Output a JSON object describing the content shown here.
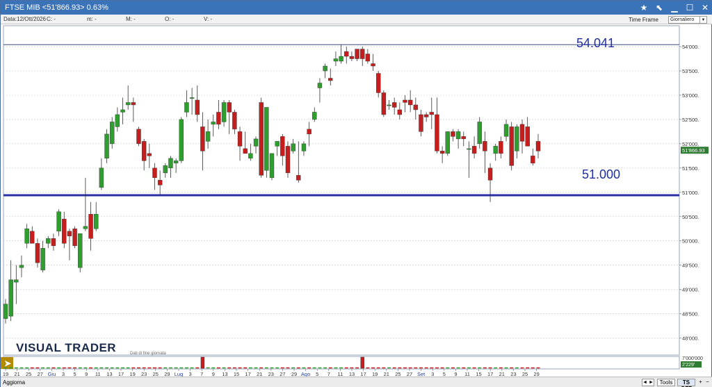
{
  "window": {
    "title": "FTSE MIB <51'866.93> 0.63%"
  },
  "infobar": {
    "date": "Data:12/Ott/2026",
    "c": "C:  -",
    "m": "m:  -",
    "M": "M:  -",
    "O": "O:  -",
    "V": "V:  -"
  },
  "timeframe": {
    "label": "Time Frame",
    "value": "Giornaliero"
  },
  "branding": {
    "logo": "VISUAL TRADER",
    "subtitle": "Dati di fine giornata"
  },
  "annotations": {
    "upper": "54.041",
    "lower": "51.000"
  },
  "price_label": "51'866.93",
  "volume_labels": {
    "top": "7'000'000",
    "current": "2'229'"
  },
  "statusbar": {
    "aggiorna": "Aggiorna",
    "tools": "Tools",
    "tsoff": "TS OFF",
    "plus": "+",
    "minus": "−",
    "scroll": "◄ ►"
  },
  "chart_data": {
    "type": "candlestick",
    "y_ticks": [
      54000,
      53500,
      53000,
      52500,
      52000,
      51500,
      51000,
      50500,
      50000,
      49500,
      49000,
      48500,
      48000
    ],
    "y_tick_labels": [
      "54'000.",
      "53'500.",
      "53'000.",
      "52'500.",
      "52'000.",
      "51'500.",
      "51'000.",
      "50'500.",
      "50'000.",
      "49'500.",
      "49'000.",
      "48'500.",
      "48'000."
    ],
    "ylim": [
      47600,
      54400
    ],
    "horizontal_lines": [
      54041,
      50940
    ],
    "x_tick_labels": [
      "19",
      "21",
      "25",
      "27",
      "Giu",
      "3",
      "5",
      "9",
      "11",
      "13",
      "17",
      "19",
      "23",
      "25",
      "29",
      "Lug",
      "3",
      "7",
      "9",
      "13",
      "15",
      "17",
      "21",
      "23",
      "27",
      "29",
      "Ago",
      "5",
      "7",
      "11",
      "13",
      "17",
      "19",
      "21",
      "25",
      "27",
      "Set",
      "3",
      "5",
      "9",
      "11",
      "15",
      "17",
      "21",
      "23",
      "25",
      "29"
    ],
    "month_labels": [
      "Giu",
      "Lug",
      "Ago",
      "Set"
    ],
    "current_price": 51866.93,
    "candles": [
      {
        "o": 48400,
        "h": 48800,
        "l": 48300,
        "c": 48700
      },
      {
        "o": 48450,
        "h": 49600,
        "l": 48350,
        "c": 49200
      },
      {
        "o": 49150,
        "h": 49500,
        "l": 48700,
        "c": 49200
      },
      {
        "o": 49450,
        "h": 49700,
        "l": 49250,
        "c": 49500
      },
      {
        "o": 49950,
        "h": 50350,
        "l": 49850,
        "c": 50250
      },
      {
        "o": 50200,
        "h": 50300,
        "l": 49950,
        "c": 49950
      },
      {
        "o": 49950,
        "h": 50050,
        "l": 49450,
        "c": 49550
      },
      {
        "o": 49400,
        "h": 50000,
        "l": 49350,
        "c": 49850
      },
      {
        "o": 49950,
        "h": 50100,
        "l": 49850,
        "c": 50050
      },
      {
        "o": 50050,
        "h": 50150,
        "l": 49800,
        "c": 49900
      },
      {
        "o": 50200,
        "h": 50650,
        "l": 50100,
        "c": 50600
      },
      {
        "o": 50450,
        "h": 50600,
        "l": 49850,
        "c": 49950
      },
      {
        "o": 50200,
        "h": 50250,
        "l": 49600,
        "c": 50100
      },
      {
        "o": 50250,
        "h": 50300,
        "l": 49850,
        "c": 49900
      },
      {
        "o": 49450,
        "h": 50150,
        "l": 49350,
        "c": 50150
      },
      {
        "o": 50250,
        "h": 51300,
        "l": 50200,
        "c": 50300
      },
      {
        "o": 50550,
        "h": 50800,
        "l": 49800,
        "c": 50050
      },
      {
        "o": 50250,
        "h": 50800,
        "l": 50200,
        "c": 50550
      },
      {
        "o": 51100,
        "h": 51700,
        "l": 51050,
        "c": 51500
      },
      {
        "o": 51700,
        "h": 52300,
        "l": 51600,
        "c": 52200
      },
      {
        "o": 52000,
        "h": 52550,
        "l": 51900,
        "c": 52450
      },
      {
        "o": 52350,
        "h": 52750,
        "l": 52250,
        "c": 52600
      },
      {
        "o": 52650,
        "h": 52950,
        "l": 52400,
        "c": 52700
      },
      {
        "o": 52800,
        "h": 53200,
        "l": 52700,
        "c": 52850
      },
      {
        "o": 52850,
        "h": 52950,
        "l": 52450,
        "c": 52800
      },
      {
        "o": 52300,
        "h": 52350,
        "l": 51950,
        "c": 52000
      },
      {
        "o": 52050,
        "h": 52100,
        "l": 51450,
        "c": 51650
      },
      {
        "o": 51800,
        "h": 52000,
        "l": 51500,
        "c": 51750
      },
      {
        "o": 51500,
        "h": 51600,
        "l": 51050,
        "c": 51300
      },
      {
        "o": 51250,
        "h": 51450,
        "l": 50950,
        "c": 51150
      },
      {
        "o": 51400,
        "h": 51600,
        "l": 51300,
        "c": 51550
      },
      {
        "o": 51500,
        "h": 51750,
        "l": 51300,
        "c": 51700
      },
      {
        "o": 51600,
        "h": 51700,
        "l": 51400,
        "c": 51650
      },
      {
        "o": 51650,
        "h": 52550,
        "l": 51600,
        "c": 52500
      },
      {
        "o": 52650,
        "h": 53100,
        "l": 52550,
        "c": 52850
      },
      {
        "o": 52950,
        "h": 53150,
        "l": 52600,
        "c": 52950
      },
      {
        "o": 52900,
        "h": 53200,
        "l": 52450,
        "c": 52600
      },
      {
        "o": 52350,
        "h": 52650,
        "l": 51450,
        "c": 51850
      },
      {
        "o": 52050,
        "h": 52500,
        "l": 51900,
        "c": 52250
      },
      {
        "o": 52400,
        "h": 52600,
        "l": 52150,
        "c": 52450
      },
      {
        "o": 52650,
        "h": 52900,
        "l": 52300,
        "c": 52400
      },
      {
        "o": 52450,
        "h": 52900,
        "l": 52350,
        "c": 52850
      },
      {
        "o": 52850,
        "h": 52900,
        "l": 52200,
        "c": 52650
      },
      {
        "o": 52650,
        "h": 52700,
        "l": 52200,
        "c": 52300
      },
      {
        "o": 52250,
        "h": 52350,
        "l": 51650,
        "c": 51950
      },
      {
        "o": 51900,
        "h": 52250,
        "l": 51800,
        "c": 51800
      },
      {
        "o": 51700,
        "h": 52000,
        "l": 51650,
        "c": 51800
      },
      {
        "o": 51950,
        "h": 52150,
        "l": 51800,
        "c": 52100
      },
      {
        "o": 52850,
        "h": 52950,
        "l": 51300,
        "c": 51350
      },
      {
        "o": 51450,
        "h": 52750,
        "l": 51300,
        "c": 52750
      },
      {
        "o": 51300,
        "h": 51800,
        "l": 51250,
        "c": 51800
      },
      {
        "o": 51950,
        "h": 52050,
        "l": 51750,
        "c": 52050
      },
      {
        "o": 52150,
        "h": 52200,
        "l": 51550,
        "c": 51750
      },
      {
        "o": 51950,
        "h": 52050,
        "l": 51300,
        "c": 51400
      },
      {
        "o": 51850,
        "h": 52100,
        "l": 51800,
        "c": 52000
      },
      {
        "o": 51350,
        "h": 52050,
        "l": 51200,
        "c": 51250
      },
      {
        "o": 51850,
        "h": 52050,
        "l": 51750,
        "c": 52000
      },
      {
        "o": 52300,
        "h": 52450,
        "l": 51950,
        "c": 52200
      },
      {
        "o": 52500,
        "h": 52750,
        "l": 52450,
        "c": 52650
      },
      {
        "o": 53150,
        "h": 53350,
        "l": 52850,
        "c": 53250
      },
      {
        "o": 53500,
        "h": 53650,
        "l": 53350,
        "c": 53600
      },
      {
        "o": 53350,
        "h": 53550,
        "l": 53200,
        "c": 53300
      },
      {
        "o": 53700,
        "h": 53900,
        "l": 53600,
        "c": 53750
      },
      {
        "o": 53700,
        "h": 54050,
        "l": 53650,
        "c": 53800
      },
      {
        "o": 53900,
        "h": 54000,
        "l": 53650,
        "c": 53800
      },
      {
        "o": 53800,
        "h": 53900,
        "l": 53700,
        "c": 53750
      },
      {
        "o": 53950,
        "h": 53950,
        "l": 53700,
        "c": 53750
      },
      {
        "o": 53950,
        "h": 54000,
        "l": 53600,
        "c": 53750
      },
      {
        "o": 53850,
        "h": 53950,
        "l": 53650,
        "c": 53700
      },
      {
        "o": 53650,
        "h": 53850,
        "l": 53500,
        "c": 53600
      },
      {
        "o": 53450,
        "h": 53500,
        "l": 52950,
        "c": 53050
      },
      {
        "o": 53050,
        "h": 53100,
        "l": 52550,
        "c": 52600
      },
      {
        "o": 52800,
        "h": 52900,
        "l": 52700,
        "c": 52800
      },
      {
        "o": 52850,
        "h": 52950,
        "l": 52600,
        "c": 52750
      },
      {
        "o": 52700,
        "h": 52850,
        "l": 52500,
        "c": 52600
      },
      {
        "o": 52900,
        "h": 53000,
        "l": 52650,
        "c": 52850
      },
      {
        "o": 52900,
        "h": 53100,
        "l": 52650,
        "c": 52800
      },
      {
        "o": 52800,
        "h": 52950,
        "l": 52500,
        "c": 52700
      },
      {
        "o": 52600,
        "h": 52700,
        "l": 52150,
        "c": 52250
      },
      {
        "o": 52600,
        "h": 52650,
        "l": 52450,
        "c": 52550
      },
      {
        "o": 52650,
        "h": 52950,
        "l": 52300,
        "c": 52600
      },
      {
        "o": 52600,
        "h": 52950,
        "l": 51800,
        "c": 51850
      },
      {
        "o": 51850,
        "h": 51950,
        "l": 51600,
        "c": 51800
      },
      {
        "o": 51800,
        "h": 52250,
        "l": 51750,
        "c": 52250
      },
      {
        "o": 52250,
        "h": 52300,
        "l": 52050,
        "c": 52150
      },
      {
        "o": 52100,
        "h": 52300,
        "l": 51900,
        "c": 52250
      },
      {
        "o": 52150,
        "h": 52250,
        "l": 51950,
        "c": 52100
      },
      {
        "o": 51900,
        "h": 52050,
        "l": 51300,
        "c": 51900
      },
      {
        "o": 51950,
        "h": 52150,
        "l": 51700,
        "c": 51800
      },
      {
        "o": 52000,
        "h": 52550,
        "l": 51900,
        "c": 52450
      },
      {
        "o": 52050,
        "h": 52250,
        "l": 51400,
        "c": 51850
      },
      {
        "o": 51500,
        "h": 51600,
        "l": 50800,
        "c": 51250
      },
      {
        "o": 51800,
        "h": 52000,
        "l": 51650,
        "c": 51950
      },
      {
        "o": 52050,
        "h": 52150,
        "l": 51700,
        "c": 51800
      },
      {
        "o": 52150,
        "h": 52500,
        "l": 52050,
        "c": 52400
      },
      {
        "o": 52350,
        "h": 52450,
        "l": 51450,
        "c": 51550
      },
      {
        "o": 51850,
        "h": 52400,
        "l": 51700,
        "c": 52350
      },
      {
        "o": 52400,
        "h": 52500,
        "l": 51800,
        "c": 52050
      },
      {
        "o": 52350,
        "h": 52550,
        "l": 51950,
        "c": 51950
      },
      {
        "o": 51750,
        "h": 51900,
        "l": 51550,
        "c": 51600
      },
      {
        "o": 52050,
        "h": 52200,
        "l": 51700,
        "c": 51850
      }
    ],
    "volume_spikes": [
      {
        "index": 37,
        "value": 7000000
      },
      {
        "index": 67,
        "value": 7000000
      }
    ],
    "colors": {
      "up": "#2e9e2e",
      "down": "#c41e1e",
      "support_line": "#2a2fa8",
      "resistance_line": "#3a4f86",
      "annotation": "#1f2ea0",
      "price_label_bg": "#2e7d32"
    }
  },
  "icons": {
    "star": "star-icon",
    "tool": "pointer-icon",
    "minimize": "minimize-icon",
    "maximize": "maximize-icon",
    "close": "close-icon",
    "expand": "expand-arrow-icon"
  }
}
